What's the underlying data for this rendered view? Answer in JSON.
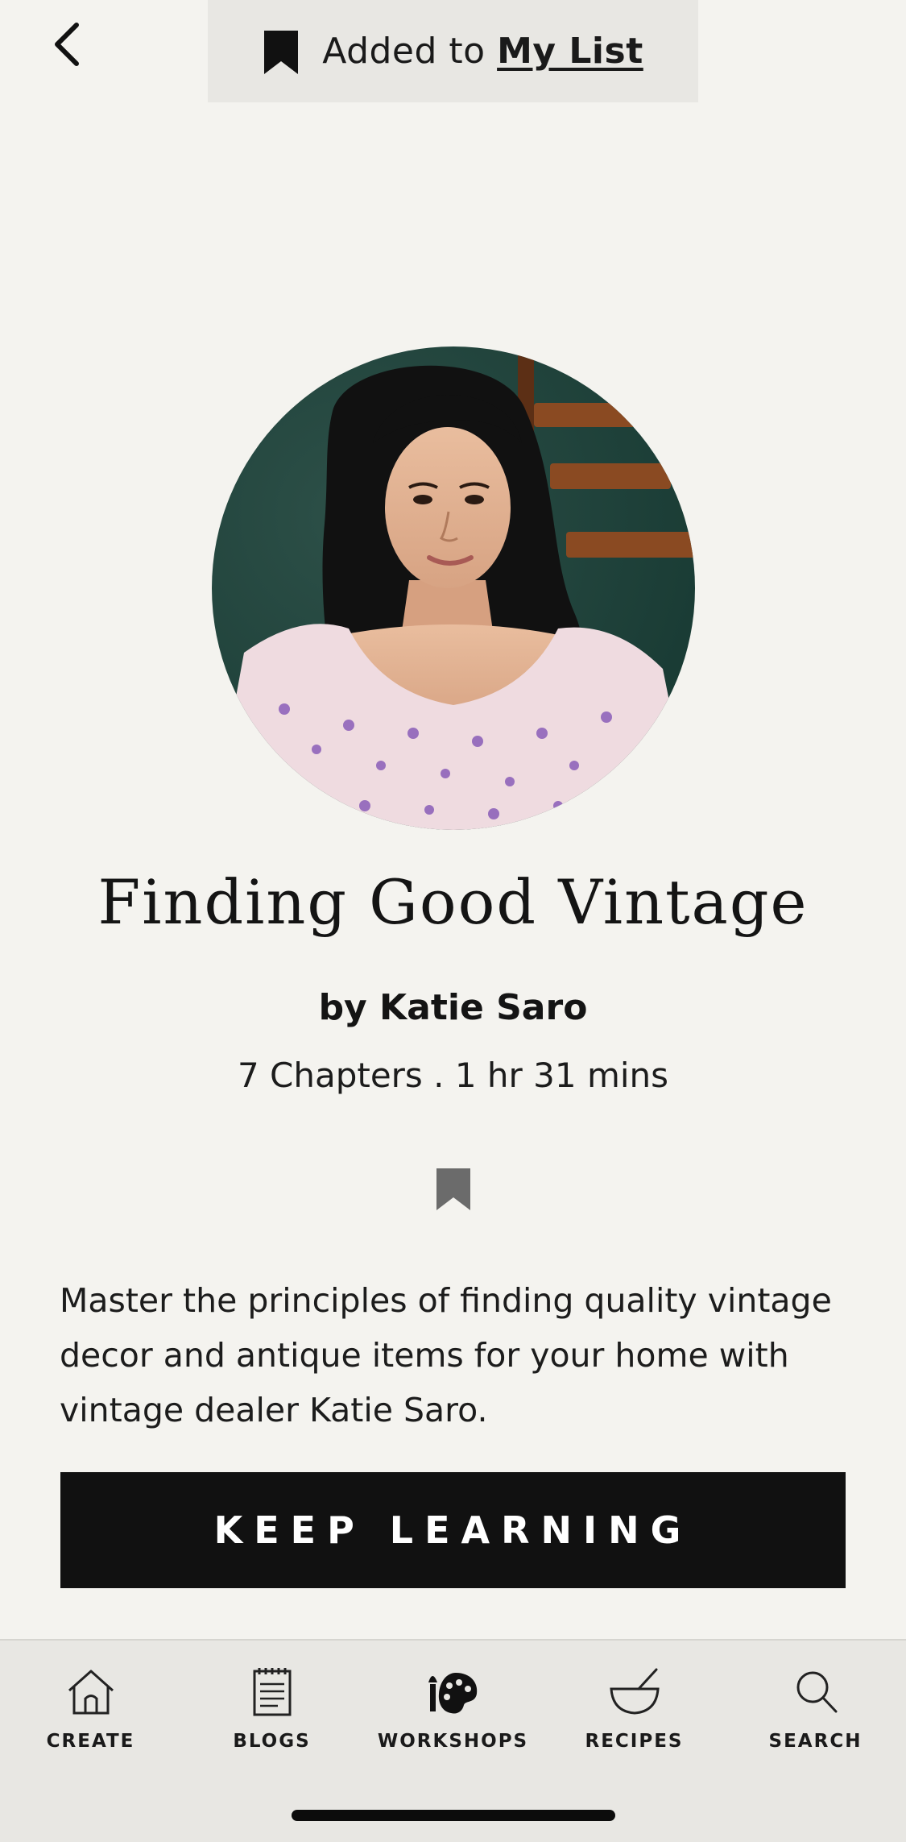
{
  "header": {
    "back_icon": "chevron-left-icon",
    "toast": {
      "icon": "bookmark-filled-icon",
      "prefix": "Added to",
      "link_text": "My List"
    }
  },
  "workshop": {
    "title": "Finding Good Vintage",
    "author": "by Katie Saro",
    "meta": "7 Chapters . 1 hr 31 mins",
    "save_icon": "bookmark-filled-icon",
    "description": "Master the principles of finding quality vintage decor and antique items for your home with vintage dealer Katie Saro.",
    "cta_label": "KEEP LEARNING"
  },
  "tabbar": {
    "tabs": [
      {
        "label": "CREATE",
        "icon": "house-icon"
      },
      {
        "label": "BLOGS",
        "icon": "notepad-icon"
      },
      {
        "label": "WORKSHOPS",
        "icon": "palette-icon"
      },
      {
        "label": "RECIPES",
        "icon": "mortar-bowl-icon"
      },
      {
        "label": "SEARCH",
        "icon": "magnifier-icon"
      }
    ]
  },
  "colors": {
    "background": "#f4f3ef",
    "bar_background": "#e8e7e3",
    "cta_background": "#111111",
    "cta_text": "#ffffff",
    "bookmark_gray": "#6b6b6b"
  }
}
